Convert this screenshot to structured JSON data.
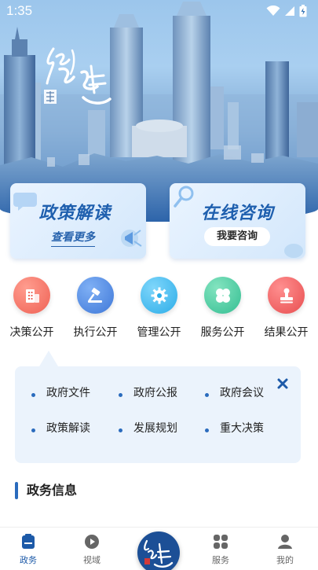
{
  "status_bar": {
    "time": "1:35"
  },
  "cards": {
    "policy": {
      "title": "政策解读",
      "link": "查看更多"
    },
    "consult": {
      "title": "在线咨询",
      "button": "我要咨询"
    }
  },
  "categories": [
    {
      "label": "决策公开",
      "icon": "building-icon",
      "color": "#f07066"
    },
    {
      "label": "执行公开",
      "icon": "gavel-icon",
      "color": "#3f7fdc"
    },
    {
      "label": "管理公开",
      "icon": "gear-icon",
      "color": "#33b6ec"
    },
    {
      "label": "服务公开",
      "icon": "clover-icon",
      "color": "#3fc79c"
    },
    {
      "label": "结果公开",
      "icon": "stamp-icon",
      "color": "#ee5c5c"
    }
  ],
  "sub_panel": {
    "items": [
      "政府文件",
      "政府公报",
      "政府会议",
      "政策解读",
      "发展规划",
      "重大决策"
    ]
  },
  "section": {
    "title": "政务信息"
  },
  "tabbar": {
    "items": [
      {
        "label": "政务",
        "icon": "document-icon",
        "active": true
      },
      {
        "label": "视域",
        "icon": "play-icon",
        "active": false
      },
      {
        "label": "服务",
        "icon": "grid-icon",
        "active": false
      },
      {
        "label": "我的",
        "icon": "person-icon",
        "active": false
      }
    ]
  },
  "colors": {
    "primary": "#1d5aa8",
    "panel_bg": "#ebf3fc"
  }
}
